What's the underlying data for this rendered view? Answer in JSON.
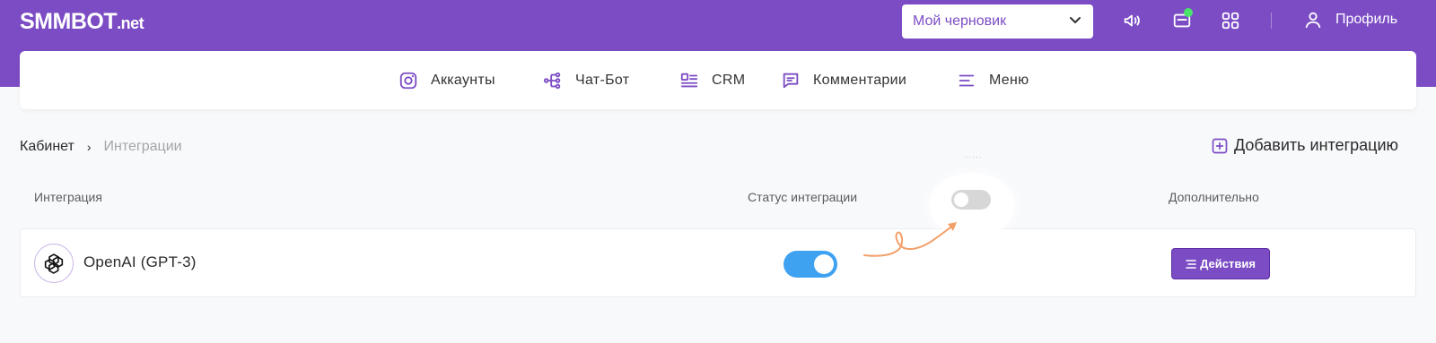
{
  "brand": {
    "name": "SMMBOT",
    "suffix": ".net"
  },
  "header": {
    "draft_select": {
      "value": "Мой черновик"
    },
    "icons": [
      "sound-icon",
      "mail-icon",
      "apps-grid-icon"
    ],
    "profile_label": "Профиль",
    "notification_color": "#49e36a"
  },
  "nav": {
    "items": [
      {
        "label": "Аккаунты",
        "icon": "instagram-icon"
      },
      {
        "label": "Чат-Бот",
        "icon": "flow-icon"
      },
      {
        "label": "CRM",
        "icon": "crm-icon"
      },
      {
        "label": "Комментарии",
        "icon": "comment-icon"
      },
      {
        "label": "Меню",
        "icon": "menu-icon"
      }
    ]
  },
  "breadcrumb": {
    "root": "Кабинет",
    "current": "Интеграции"
  },
  "add_integration_label": "Добавить интеграцию",
  "table": {
    "columns": [
      "Интеграция",
      "Статус интеграции",
      "Дополнительно"
    ],
    "rows": [
      {
        "name": "OpenAI (GPT-3)",
        "icon": "openai-icon",
        "status": "on",
        "action_label": "Действия"
      }
    ]
  },
  "colors": {
    "brand": "#7b4cc4",
    "toggle_on": "#3fa2f1",
    "annotation_arrow": "#f2a06a"
  }
}
